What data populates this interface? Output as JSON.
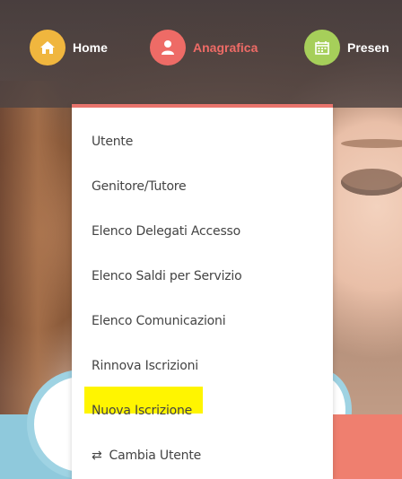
{
  "nav": {
    "items": [
      {
        "label": "Home",
        "icon": "home-icon",
        "color": "#f0b63e",
        "text_color": "#ffffff"
      },
      {
        "label": "Anagrafica",
        "icon": "user-icon",
        "color": "#ee6b66",
        "text_color": "#ee6b66"
      },
      {
        "label": "Presen",
        "icon": "calendar-icon",
        "color": "#a6cf5a",
        "text_color": "#ffffff"
      }
    ]
  },
  "dropdown": {
    "accent_color": "#e8746d",
    "items": [
      {
        "label": "Utente"
      },
      {
        "label": "Genitore/Tutore"
      },
      {
        "label": "Elenco Delegati Accesso"
      },
      {
        "label": "Elenco Saldi per Servizio"
      },
      {
        "label": "Elenco Comunicazioni"
      },
      {
        "label": "Rinnova Iscrizioni"
      },
      {
        "label": "Nuova Iscrizione",
        "highlighted": true,
        "highlight_color": "#fff500"
      },
      {
        "label": "Cambia Utente",
        "icon": "swap-arrows-icon"
      }
    ]
  }
}
